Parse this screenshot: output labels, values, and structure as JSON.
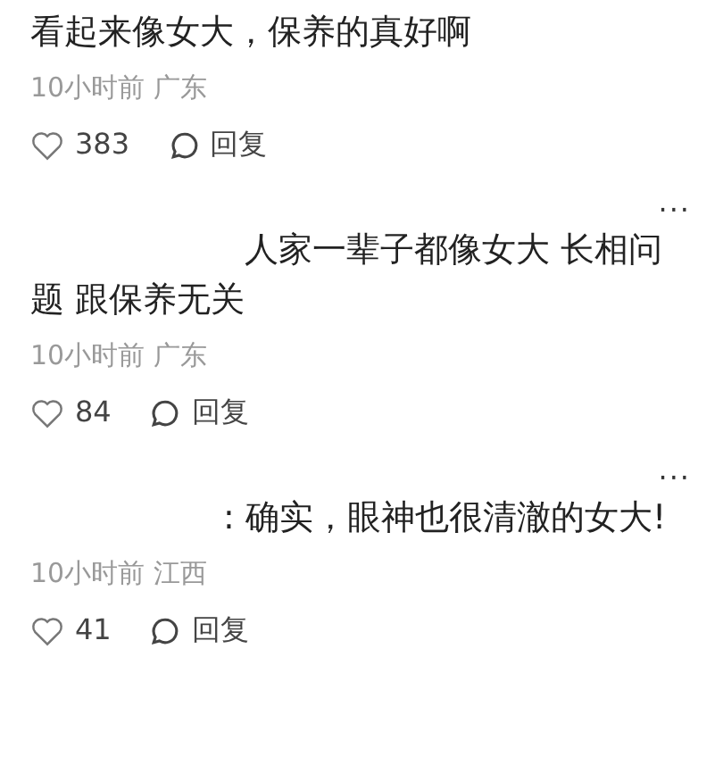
{
  "comments": [
    {
      "text": "看起来像女大，保养的真好啊",
      "time": "10小时前",
      "location": "广东",
      "likes": "383",
      "reply": "回复"
    },
    {
      "more": "···",
      "text": "人家一辈子都像女大 长相问题 跟保养无关",
      "time": "10小时前",
      "location": "广东",
      "likes": "84",
      "reply": "回复"
    },
    {
      "more": "···",
      "text": ": 确实，眼神也很清澈的女大!",
      "time": "10小时前",
      "location": "江西",
      "likes": "41",
      "reply": "回复"
    }
  ]
}
